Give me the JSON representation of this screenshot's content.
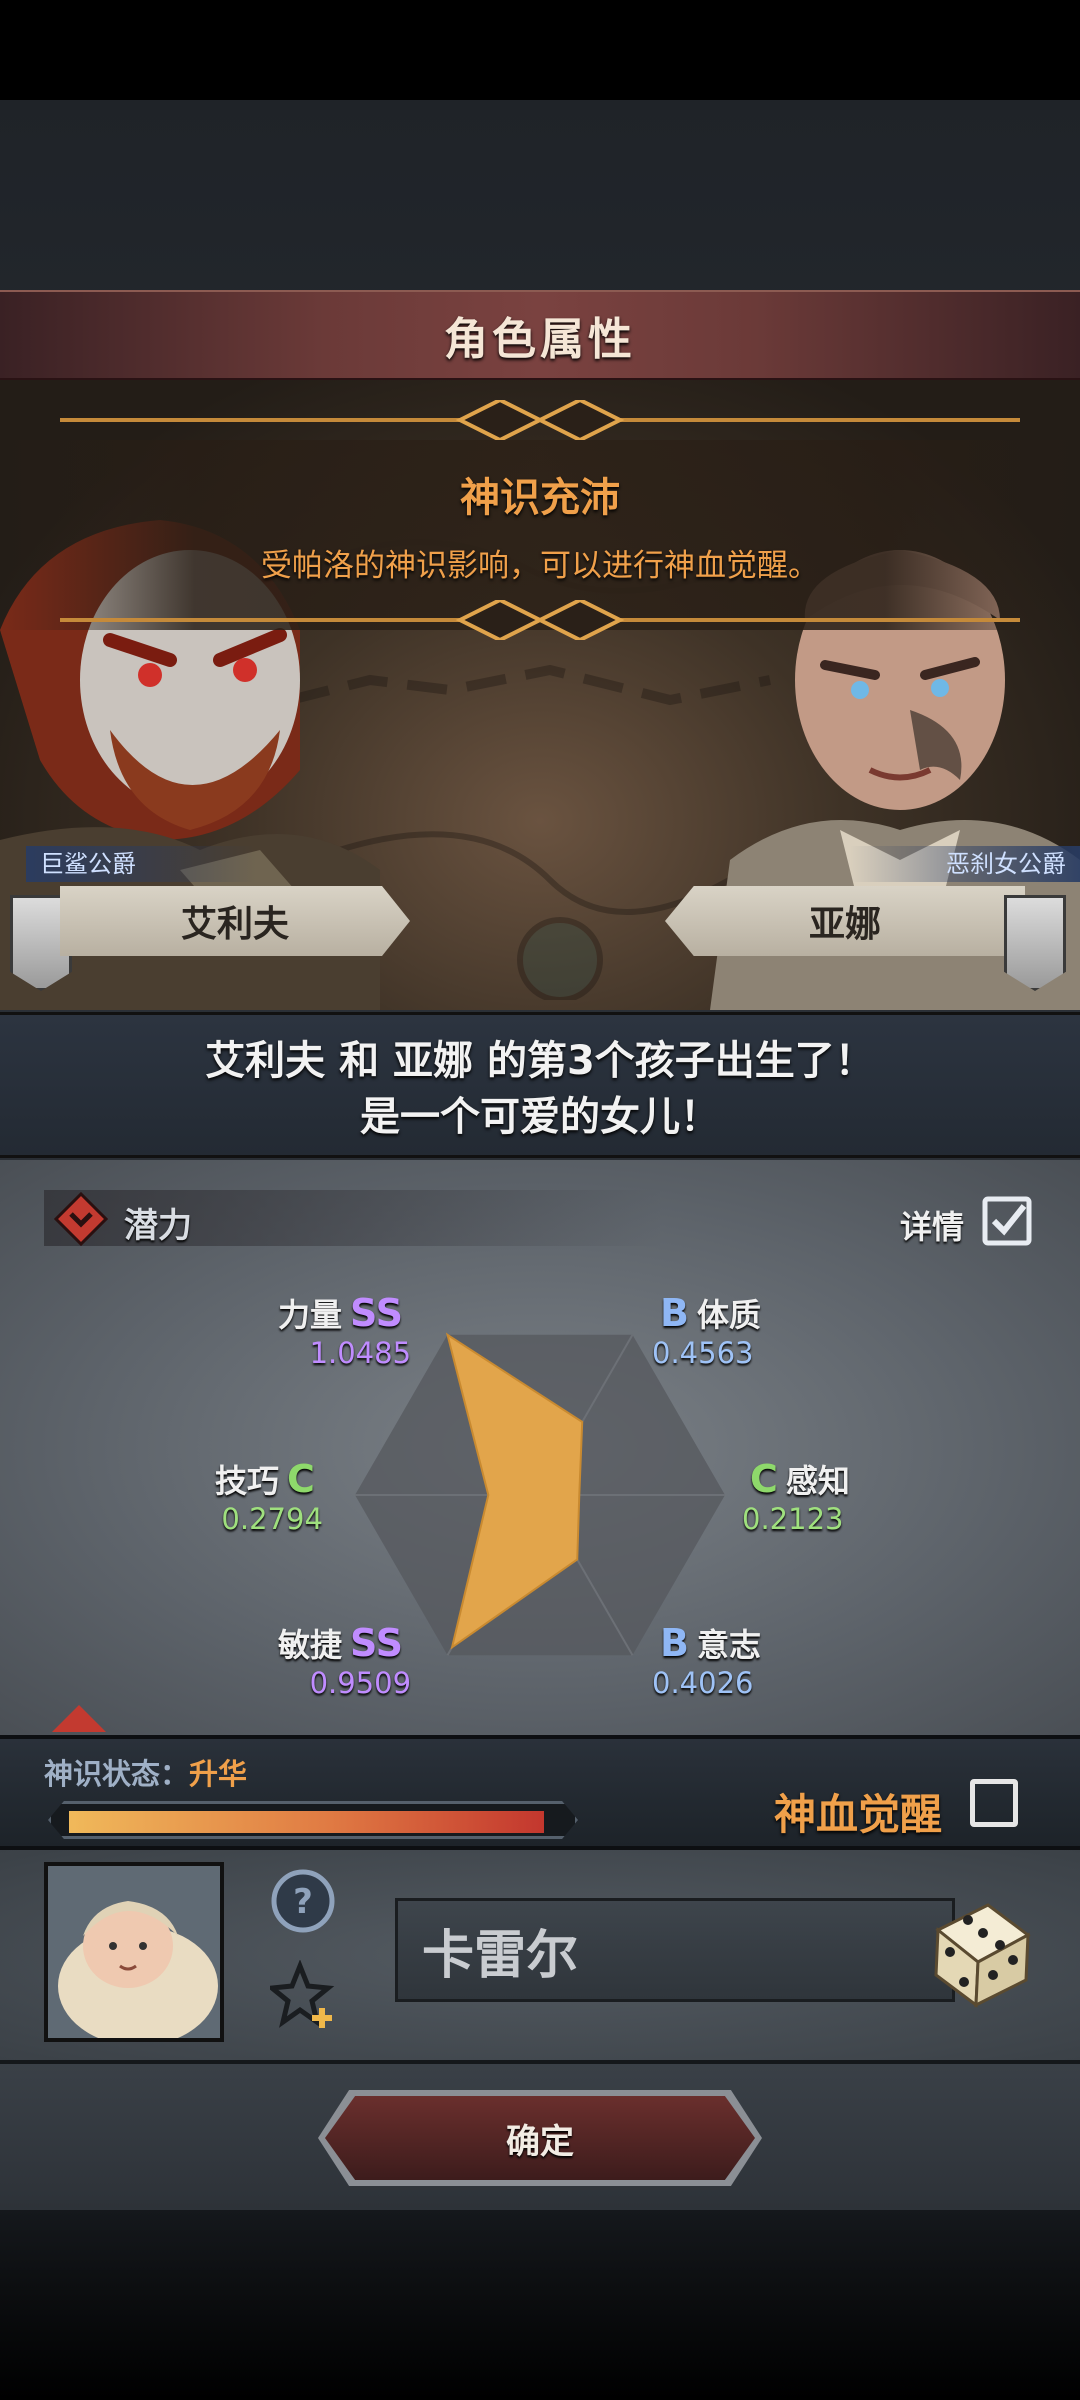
{
  "dialog": {
    "title": "角色属性"
  },
  "banner": {
    "heading": "神识充沛",
    "description": "受帕洛的神识影响，可以进行神血觉醒。"
  },
  "parents": {
    "father": {
      "name": "艾利夫",
      "title": "巨鲨公爵"
    },
    "mother": {
      "name": "亚娜",
      "title": "恶刹女公爵"
    }
  },
  "message": {
    "line1": "艾利夫 和 亚娜 的第3个孩子出生了！",
    "line2": "是一个可爱的女儿！"
  },
  "potential": {
    "label": "潜力",
    "details_label": "详情",
    "details_checked": true,
    "stats": [
      {
        "name": "力量",
        "grade": "SS",
        "value": "1.0485",
        "fraction": 1.0485
      },
      {
        "name": "体质",
        "grade": "B",
        "value": "0.4563",
        "fraction": 0.4563
      },
      {
        "name": "感知",
        "grade": "C",
        "value": "0.2123",
        "fraction": 0.2123
      },
      {
        "name": "意志",
        "grade": "B",
        "value": "0.4026",
        "fraction": 0.4026
      },
      {
        "name": "敏捷",
        "grade": "SS",
        "value": "0.9509",
        "fraction": 0.9509
      },
      {
        "name": "技巧",
        "grade": "C",
        "value": "0.2794",
        "fraction": 0.2794
      }
    ],
    "fill_color": "#e2a54b"
  },
  "divine": {
    "status_prefix": "神识状态：",
    "status_value": "升华",
    "progress_fraction": 0.97,
    "awaken_label": "神血觉醒",
    "awaken_checked": false
  },
  "child": {
    "name_value": "卡雷尔",
    "icons": [
      "help-icon",
      "star-plus-icon",
      "dice-icon"
    ]
  },
  "footer": {
    "confirm_label": "确定"
  },
  "colors": {
    "accent_orange": "#f0a04a",
    "grade_ss": "#c08cff",
    "grade_b": "#8fb7f5",
    "grade_c": "#8ed96b"
  }
}
